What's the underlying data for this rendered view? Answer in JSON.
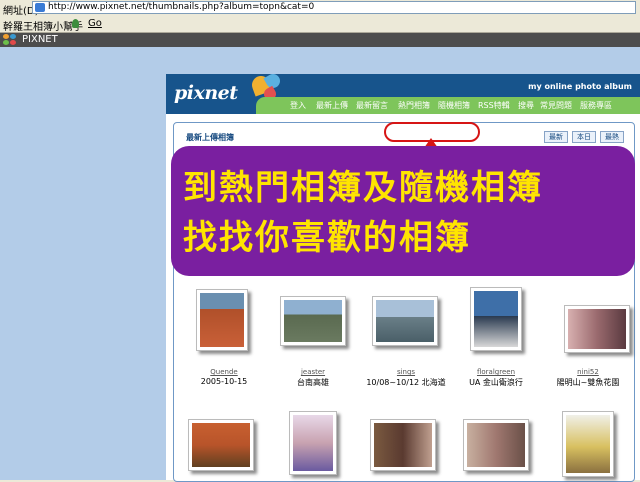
{
  "browser": {
    "address_label": "網址(D)",
    "url": "http://www.pixnet.net/thumbnails.php?album=topn&cat=0",
    "links_label": "幹羅王相簿小幫手",
    "go_label": "Go"
  },
  "page_title_bar": {
    "title": "PIXNET"
  },
  "site": {
    "brand": "pixnet",
    "tagline": "my online photo album",
    "nav": [
      {
        "label": "登入"
      },
      {
        "label": "最新上傳"
      },
      {
        "label": "最新留言"
      },
      {
        "label": "熱門相簿"
      },
      {
        "label": "隨機相簿"
      },
      {
        "label": "RSS特輯"
      },
      {
        "label": "搜尋"
      },
      {
        "label": "常見問題"
      },
      {
        "label": "服務專區"
      }
    ],
    "content_title": "最新上傳相簿",
    "buttons": [
      {
        "label": "最新"
      },
      {
        "label": "本日"
      },
      {
        "label": "最熱"
      }
    ]
  },
  "overlay": {
    "line1": "到熱門相簿及隨機相簿",
    "line2": "找找你喜歡的相簿"
  },
  "albums_row1": [
    {
      "user": "Quende",
      "caption": "2005-10-15",
      "img": "#8a6b3e"
    },
    {
      "user": "jeaster",
      "caption": "台南高雄",
      "img": "#5e7fa0"
    },
    {
      "user": "sings",
      "caption": "10/08~10/12 北海道",
      "img": "#6a7f88"
    },
    {
      "user": "floralgreen",
      "caption": "UA 金山衛浪行",
      "img": "#3e6fa8"
    },
    {
      "user": "nini52",
      "caption": "陽明山~雙魚花園",
      "img": "#9a6a6e"
    }
  ],
  "albums_row2": [
    {
      "img": "#b8542a"
    },
    {
      "img": "#c8a2b0"
    },
    {
      "img": "#5a3a30"
    },
    {
      "img": "#a07870"
    },
    {
      "img": "#d8c060"
    }
  ],
  "colors": {
    "header_blue": "#17548c",
    "nav_green": "#7ec55b",
    "overlay_purple": "#7a1fa0",
    "overlay_text": "#ffe500",
    "highlight_red": "#d61515"
  }
}
